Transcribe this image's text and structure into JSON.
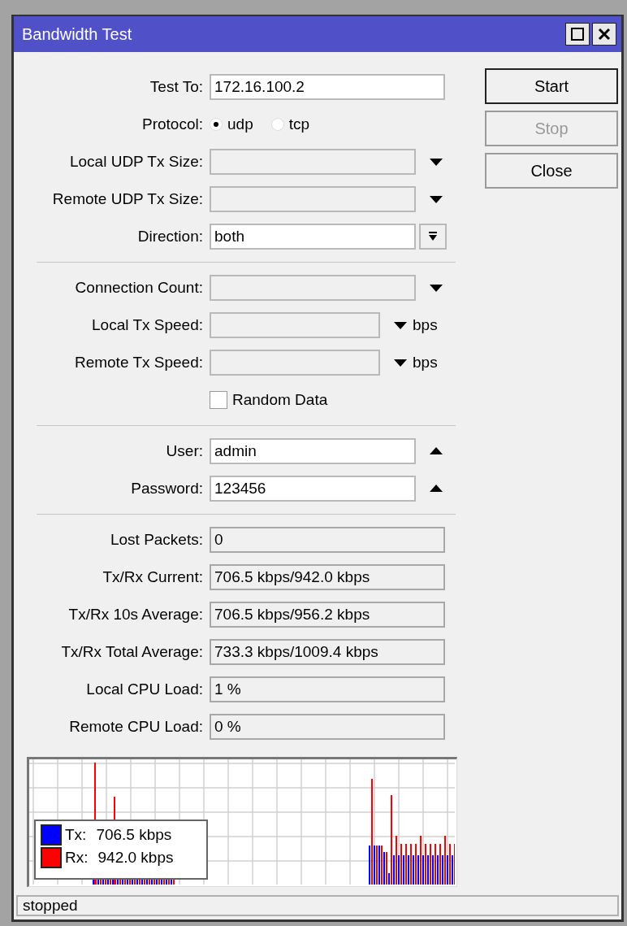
{
  "window": {
    "title": "Bandwidth Test"
  },
  "buttons": [
    {
      "label": "Start",
      "disabled": false,
      "default": true
    },
    {
      "label": "Stop",
      "disabled": true,
      "default": false
    },
    {
      "label": "Close",
      "disabled": false,
      "default": false
    }
  ],
  "rows": [
    {
      "kind": "text",
      "label": "Test To:",
      "value": "172.16.100.2"
    },
    {
      "kind": "radio",
      "label": "Protocol:",
      "options": [
        {
          "label": "udp",
          "selected": true
        },
        {
          "label": "tcp",
          "selected": false
        }
      ]
    },
    {
      "kind": "dropdown",
      "label": "Local UDP Tx Size:"
    },
    {
      "kind": "dropdown",
      "label": "Remote UDP Tx Size:"
    },
    {
      "kind": "select",
      "label": "Direction:",
      "value": "both"
    },
    {
      "kind": "divider"
    },
    {
      "kind": "dropdown",
      "label": "Connection Count:"
    },
    {
      "kind": "unit",
      "label": "Local Tx Speed:",
      "unit": "bps"
    },
    {
      "kind": "unit",
      "label": "Remote Tx Speed:",
      "unit": "bps"
    },
    {
      "kind": "checkbox",
      "label": "Random Data",
      "checked": false
    },
    {
      "kind": "divider"
    },
    {
      "kind": "collapse",
      "label": "User:",
      "value": "admin"
    },
    {
      "kind": "collapse",
      "label": "Password:",
      "value": "123456"
    },
    {
      "kind": "divider"
    },
    {
      "kind": "readonly",
      "label": "Lost Packets:",
      "value": "0"
    },
    {
      "kind": "readonly",
      "label": "Tx/Rx Current:",
      "value": "706.5 kbps/942.0 kbps"
    },
    {
      "kind": "readonly",
      "label": "Tx/Rx 10s Average:",
      "value": "706.5 kbps/956.2 kbps"
    },
    {
      "kind": "readonly",
      "label": "Tx/Rx Total Average:",
      "value": "733.3 kbps/1009.4 kbps"
    },
    {
      "kind": "readonly",
      "label": "Local CPU Load:",
      "value": "1 %"
    },
    {
      "kind": "readonly",
      "label": "Remote CPU Load:",
      "value": "0 %"
    }
  ],
  "graph": {
    "legend": [
      {
        "label": "Tx:",
        "value": "706.5 kbps",
        "color": "#0000ff"
      },
      {
        "label": "Rx:",
        "value": "942.0 kbps",
        "color": "#ff0000"
      }
    ]
  },
  "status_bar": {
    "text": "stopped"
  }
}
